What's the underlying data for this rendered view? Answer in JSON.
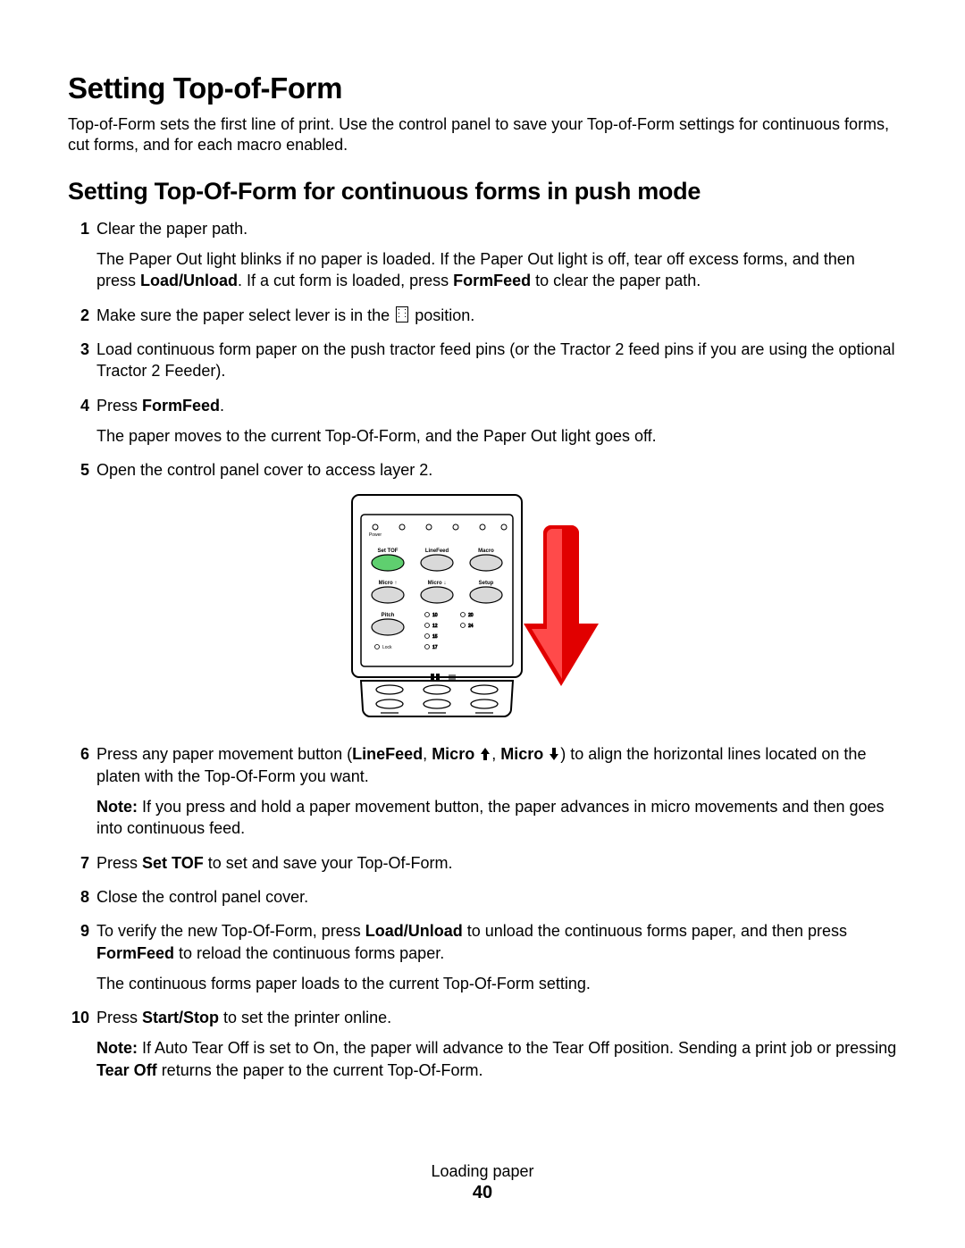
{
  "heading1": "Setting Top-of-Form",
  "intro": "Top-of-Form sets the first line of print. Use the control panel to save your Top-of-Form settings for continuous forms, cut forms, and for each macro enabled.",
  "heading2": "Setting Top-Of-Form for continuous forms in push mode",
  "steps": {
    "s1a": "Clear the paper path.",
    "s1b_pre": "The Paper Out light blinks if no paper is loaded. If the Paper Out light is off, tear off excess forms, and then press ",
    "s1b_b1": "Load/Unload",
    "s1b_mid": ". If a cut form is loaded, press ",
    "s1b_b2": "FormFeed",
    "s1b_post": " to clear the paper path.",
    "s2_pre": "Make sure the paper select lever is in the ",
    "s2_post": " position.",
    "s3": "Load continuous form paper on the push tractor feed pins (or the Tractor 2 feed pins if you are using the optional Tractor 2 Feeder).",
    "s4_pre": "Press ",
    "s4_b": "FormFeed",
    "s4_post": ".",
    "s4b": "The paper moves to the current Top-Of-Form, and the Paper Out light goes off.",
    "s5": "Open the control panel cover to access layer 2.",
    "s6_pre": "Press any paper movement button (",
    "s6_b1": "LineFeed",
    "s6_sep1": ", ",
    "s6_b2": "Micro ",
    "s6_sep2": ", ",
    "s6_b3": "Micro ",
    "s6_post": ") to align the horizontal lines located on the platen with the Top-Of-Form you want.",
    "s6_note_label": "Note:",
    "s6_note": " If you press and hold a paper movement button, the paper advances in micro movements and then goes into continuous feed.",
    "s7_pre": "Press ",
    "s7_b": "Set TOF",
    "s7_post": " to set and save your Top-Of-Form.",
    "s8": "Close the control panel cover.",
    "s9_pre": "To verify the new Top-Of-Form, press ",
    "s9_b1": "Load/Unload",
    "s9_mid": " to unload the continuous forms paper, and then press ",
    "s9_b2": "FormFeed",
    "s9_post": " to reload the continuous forms paper.",
    "s9b": "The continuous forms paper loads to the current Top-Of-Form setting.",
    "s10_pre": "Press ",
    "s10_b": "Start/Stop",
    "s10_post": " to set the printer online.",
    "s10_note_label": "Note:",
    "s10_note_pre": " If Auto Tear Off is set to On, the paper will advance to the Tear Off position. Sending a print job or pressing ",
    "s10_note_b": "Tear Off",
    "s10_note_post": " returns the paper to the current Top-Of-Form."
  },
  "panel": {
    "row1": [
      "Set TOF",
      "LineFeed",
      "Macro"
    ],
    "row2": [
      "Micro ↑",
      "Micro ↓",
      "Setup"
    ],
    "pitch": "Pitch",
    "lock": "Lock",
    "power": "Power",
    "pitch_values": [
      "10",
      "12",
      "15",
      "17",
      "20",
      "24"
    ]
  },
  "footer_section": "Loading paper",
  "page_number": "40"
}
